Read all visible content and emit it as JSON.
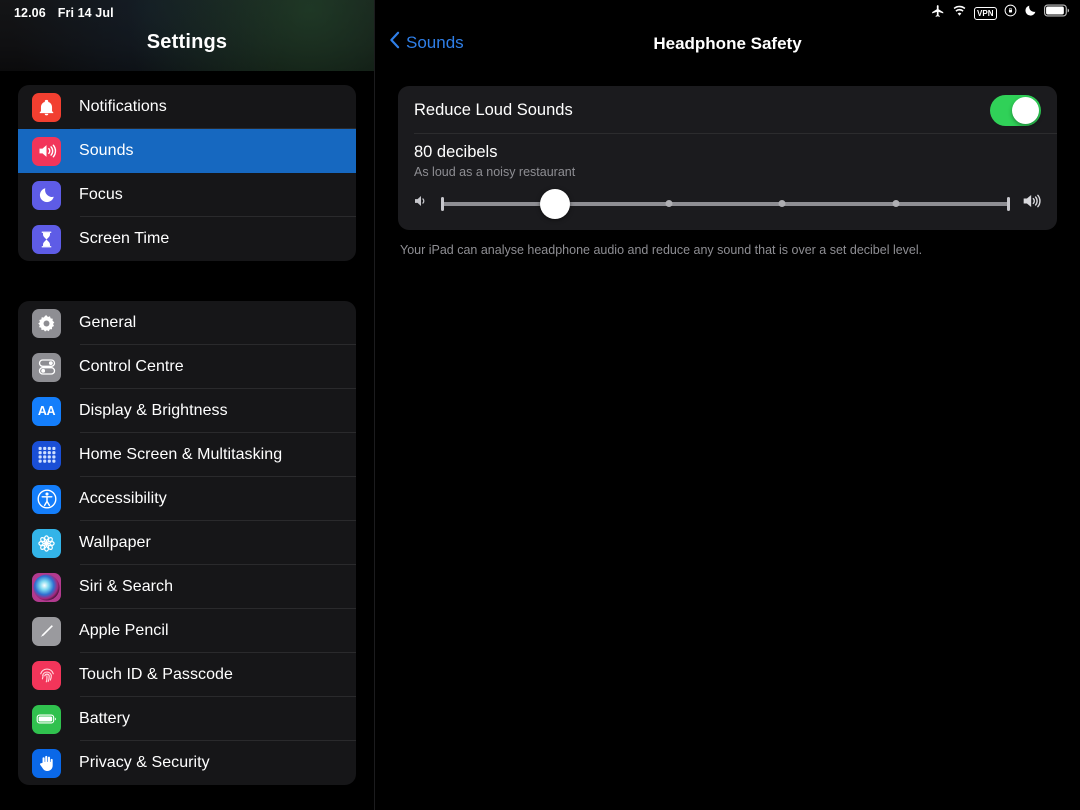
{
  "status_bar": {
    "time": "12.06",
    "date": "Fri 14 Jul",
    "icons": [
      "airplane-mode-icon",
      "wifi-icon",
      "vpn-badge-icon",
      "rotation-lock-icon",
      "do-not-disturb-moon-icon",
      "battery-icon"
    ],
    "vpn_label": "VPN"
  },
  "sidebar": {
    "title": "Settings",
    "groups": [
      {
        "items": [
          {
            "label": "Notifications",
            "icon": "bell-icon",
            "color": "#f23f30",
            "selected": false
          },
          {
            "label": "Sounds",
            "icon": "speaker-waves-icon",
            "color": "#f2355a",
            "selected": true
          },
          {
            "label": "Focus",
            "icon": "crescent-moon-icon",
            "color": "#5e5ce6",
            "selected": false
          },
          {
            "label": "Screen Time",
            "icon": "hourglass-icon",
            "color": "#5e5ce6",
            "selected": false
          }
        ]
      },
      {
        "items": [
          {
            "label": "General",
            "icon": "gear-icon",
            "color": "#8e8e93",
            "selected": false
          },
          {
            "label": "Control Centre",
            "icon": "toggles-icon",
            "color": "#8e8e93",
            "selected": false
          },
          {
            "label": "Display & Brightness",
            "icon": "aa-text-icon",
            "color": "#147efb",
            "selected": false
          },
          {
            "label": "Home Screen & Multitasking",
            "icon": "app-grid-icon",
            "color": "#1a4fd6",
            "selected": false
          },
          {
            "label": "Accessibility",
            "icon": "accessibility-person-icon",
            "color": "#147efb",
            "selected": false
          },
          {
            "label": "Wallpaper",
            "icon": "flower-icon",
            "color": "#33b4e8",
            "selected": false
          },
          {
            "label": "Siri & Search",
            "icon": "siri-orb-icon",
            "color": "#b23a8f",
            "selected": false
          },
          {
            "label": "Apple Pencil",
            "icon": "pencil-icon",
            "color": "#9a9a9e",
            "selected": false
          },
          {
            "label": "Touch ID & Passcode",
            "icon": "fingerprint-icon",
            "color": "#f2355a",
            "selected": false
          },
          {
            "label": "Battery",
            "icon": "battery-icon",
            "color": "#30c14e",
            "selected": false
          },
          {
            "label": "Privacy & Security",
            "icon": "hand-raised-icon",
            "color": "#0a68e8",
            "selected": false
          }
        ]
      }
    ]
  },
  "detail": {
    "back_label": "Sounds",
    "back_icon": "chevron-left-icon",
    "title": "Headphone Safety",
    "reduce_loud_sounds": {
      "label": "Reduce Loud Sounds",
      "toggle_on": true,
      "toggle_color": "#30d158"
    },
    "decibel": {
      "value_label": "80 decibels",
      "description": "As loud as a noisy restaurant",
      "slider_percent": 20,
      "ticks_percent": [
        0,
        40,
        60,
        80,
        100
      ],
      "left_icon": "speaker-low-icon",
      "right_icon": "speaker-high-icon"
    },
    "footnote": "Your iPad can analyse headphone audio and reduce any sound that is over a set decibel level."
  }
}
